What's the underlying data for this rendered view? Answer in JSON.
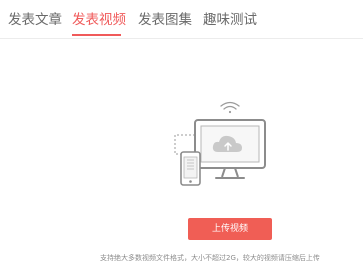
{
  "tabs": [
    {
      "label": "发表文章",
      "active": false
    },
    {
      "label": "发表视频",
      "active": true
    },
    {
      "label": "发表图集",
      "active": false
    },
    {
      "label": "趣味测试",
      "active": false
    }
  ],
  "upload": {
    "button_label": "上传视频",
    "hint": "支持绝大多数视频文件格式，大小不超过2G，较大的视频请压缩后上传"
  },
  "icons": {
    "illustration": "video-upload-devices-icon"
  },
  "colors": {
    "accent": "#f05a5a",
    "illustration_gray": "#9b9b9b",
    "text_gray": "#6a6a6a"
  }
}
